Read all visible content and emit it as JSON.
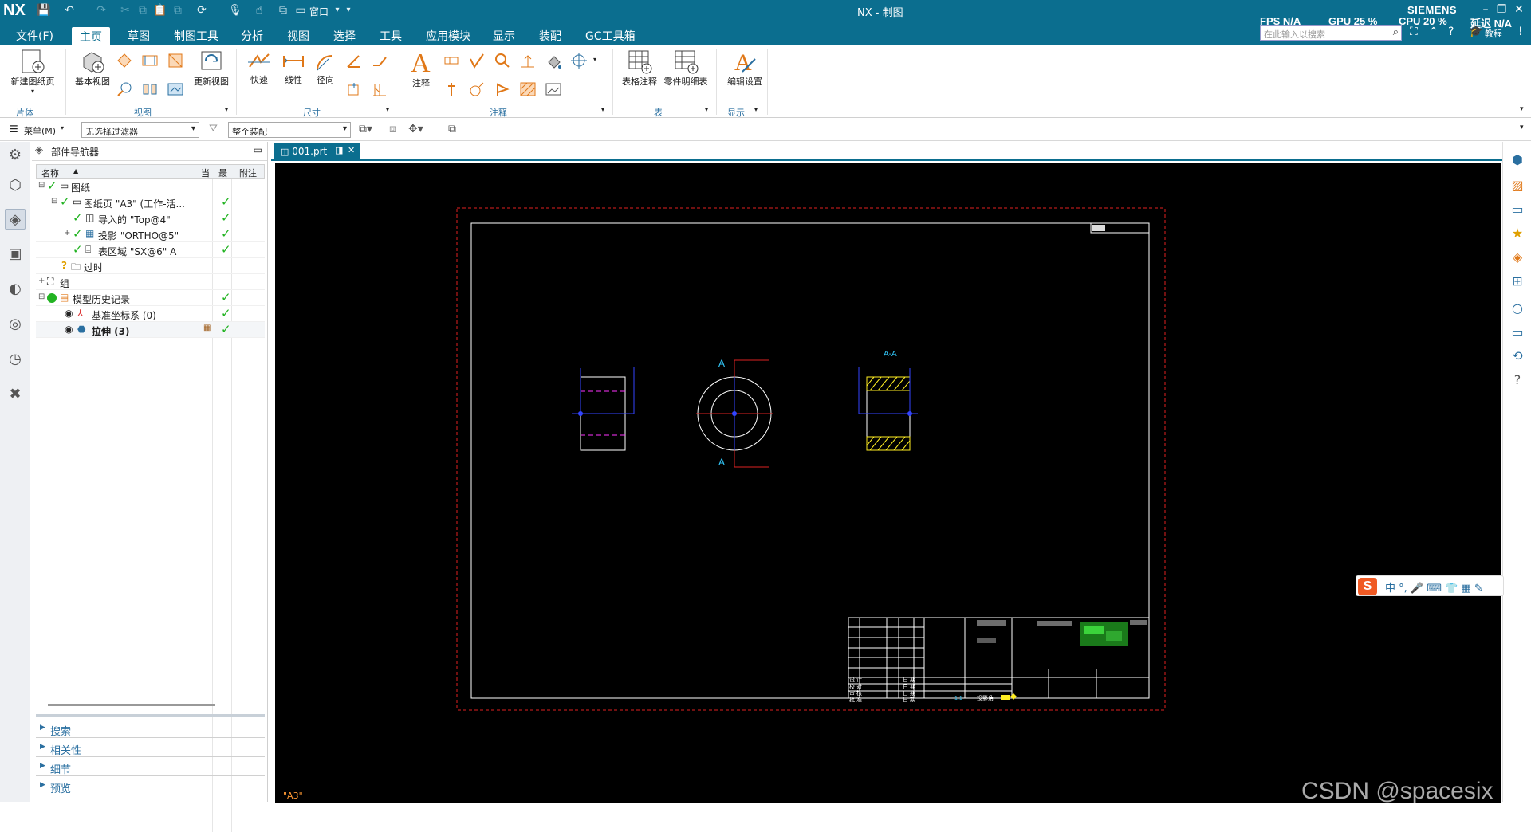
{
  "window": {
    "logo": "NX",
    "title": "NX - 制图",
    "brand": "SIEMENS",
    "window_menu_label": "窗口",
    "stats": {
      "fps": "FPS N/A",
      "gpu": "GPU 25 %",
      "cpu": "CPU 20 %",
      "delay": "延迟 N/A"
    }
  },
  "menu_tabs": [
    "文件(F)",
    "主页",
    "草图",
    "制图工具",
    "分析",
    "视图",
    "选择",
    "工具",
    "应用模块",
    "显示",
    "装配",
    "GC工具箱"
  ],
  "active_tab": "主页",
  "search": {
    "placeholder": "在此输入以搜索"
  },
  "tutorial_label": "教程",
  "ribbon": {
    "groups": [
      "片体",
      "视图",
      "尺寸",
      "注释",
      "表",
      "显示"
    ],
    "buttons": {
      "new_sheet": "新建图纸页",
      "base_view": "基本视图",
      "update_view": "更新视图",
      "rapid": "快速",
      "linear": "线性",
      "radial": "径向",
      "note": "注释",
      "tabular_note": "表格注释",
      "parts_list": "零件明细表",
      "edit_settings": "编辑设置"
    }
  },
  "filterbar": {
    "menu_label": "菜单(M)",
    "filter_value": "无选择过滤器",
    "scope_value": "整个装配"
  },
  "navigator": {
    "title": "部件导航器",
    "columns": [
      "名称",
      "当",
      "最",
      "附注"
    ],
    "rows": [
      {
        "label": "图纸",
        "indent": 0,
        "check": false
      },
      {
        "label": "图纸页 \"A3\" (工作-活...",
        "indent": 1,
        "check": true
      },
      {
        "label": "导入的 \"Top@4\"",
        "indent": 2,
        "check": true
      },
      {
        "label": "投影 \"ORTHO@5\"",
        "indent": 2,
        "check": true
      },
      {
        "label": "表区域 \"SX@6\" A",
        "indent": 2,
        "check": true
      },
      {
        "label": "过时",
        "indent": 1,
        "check": false
      },
      {
        "label": "组",
        "indent": 0,
        "check": false
      },
      {
        "label": "模型历史记录",
        "indent": 0,
        "check": true
      },
      {
        "label": "基准坐标系 (0)",
        "indent": 1,
        "check": true
      },
      {
        "label": "拉伸 (3)",
        "indent": 1,
        "check": true
      }
    ],
    "panels": [
      "搜索",
      "相关性",
      "细节",
      "预览"
    ]
  },
  "document": {
    "tab": "001.prt",
    "sheet": "\"A3\""
  },
  "drawing": {
    "section_label_top": "A",
    "section_label_bottom": "A",
    "section_view_label": "A-A",
    "title_block": {
      "labels_left": [
        "设 计",
        "校 对",
        "审 核",
        "批 准"
      ],
      "labels_mid": [
        "日 期",
        "日 期",
        "日 期",
        "日 期"
      ],
      "scale": "1:1",
      "projection": "投影角"
    }
  },
  "ime": {
    "logo": "S",
    "text": "中 °, 🎤 ⌨ 👕 ▦ ✎"
  },
  "watermark": "CSDN @spacesix"
}
